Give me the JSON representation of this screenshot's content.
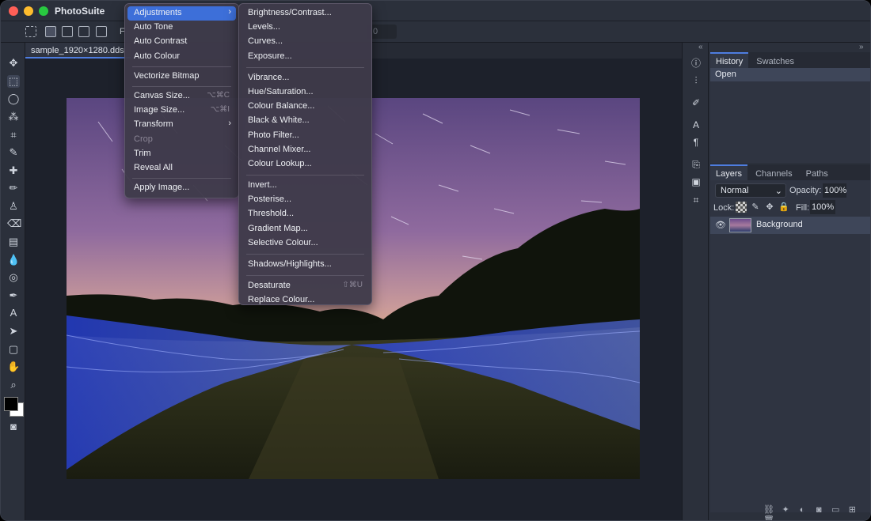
{
  "app": {
    "title": "PhotoSuite"
  },
  "options_bar": {
    "font_prefix": "F",
    "field_value": "0"
  },
  "document": {
    "tab_name": "sample_1920×1280.dds"
  },
  "image_menu": {
    "items": [
      {
        "label": "Adjustments",
        "submenu": true,
        "highlighted": true
      },
      {
        "label": "Auto Tone"
      },
      {
        "label": "Auto Contrast"
      },
      {
        "label": "Auto Colour"
      },
      {
        "separator": true
      },
      {
        "label": "Vectorize Bitmap"
      },
      {
        "separator": true
      },
      {
        "label": "Canvas Size...",
        "shortcut": "⌥⌘C"
      },
      {
        "label": "Image Size...",
        "shortcut": "⌥⌘I"
      },
      {
        "label": "Transform",
        "submenu": true
      },
      {
        "label": "Crop",
        "disabled": true
      },
      {
        "label": "Trim"
      },
      {
        "label": "Reveal All"
      },
      {
        "separator": true
      },
      {
        "label": "Apply Image..."
      }
    ]
  },
  "adjustments_menu": {
    "items": [
      {
        "label": "Brightness/Contrast..."
      },
      {
        "label": "Levels..."
      },
      {
        "label": "Curves..."
      },
      {
        "label": "Exposure..."
      },
      {
        "separator": true
      },
      {
        "label": "Vibrance..."
      },
      {
        "label": "Hue/Saturation..."
      },
      {
        "label": "Colour Balance..."
      },
      {
        "label": "Black & White..."
      },
      {
        "label": "Photo Filter..."
      },
      {
        "label": "Channel Mixer..."
      },
      {
        "label": "Colour Lookup..."
      },
      {
        "separator": true
      },
      {
        "label": "Invert..."
      },
      {
        "label": "Posterise..."
      },
      {
        "label": "Threshold..."
      },
      {
        "label": "Gradient Map..."
      },
      {
        "label": "Selective Colour..."
      },
      {
        "separator": true
      },
      {
        "label": "Shadows/Highlights..."
      },
      {
        "separator": true
      },
      {
        "label": "Desaturate",
        "shortcut": "⇧⌘U"
      },
      {
        "label": "Replace Colour..."
      }
    ]
  },
  "history_panel": {
    "tabs": [
      "History",
      "Swatches"
    ],
    "entries": [
      "Open"
    ]
  },
  "layers_panel": {
    "tabs": [
      "Layers",
      "Channels",
      "Paths"
    ],
    "blend_mode": "Normal",
    "opacity_label": "Opacity:",
    "opacity_value": "100%",
    "lock_label": "Lock:",
    "fill_label": "Fill:",
    "fill_value": "100%",
    "layers": [
      {
        "name": "Background"
      }
    ]
  },
  "colors": {
    "accent": "#3d6fd9",
    "tab_underline": "#4e7de0",
    "menu_bg": "#3e3a4a"
  }
}
